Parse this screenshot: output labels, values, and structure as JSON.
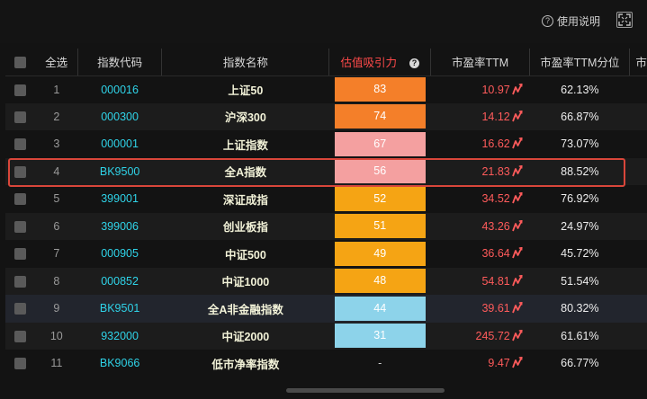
{
  "toolbar": {
    "help_label": "使用说明",
    "help_icon": "question-circle-icon",
    "fullscreen_icon": "fullscreen-icon"
  },
  "table": {
    "headers": {
      "select_all": "全选",
      "code": "指数代码",
      "name": "指数名称",
      "score": "估值吸引力",
      "pe": "市盈率TTM",
      "pe_pct": "市盈率TTM分位",
      "more": "市"
    },
    "accent_header_color": "#ff4a4a",
    "rows": [
      {
        "idx": "1",
        "code": "000016",
        "name": "上证50",
        "score": "83",
        "score_color": "#f47f29",
        "pe": "10.97",
        "pct": "62.13%"
      },
      {
        "idx": "2",
        "code": "000300",
        "name": "沪深300",
        "score": "74",
        "score_color": "#f47f29",
        "pe": "14.12",
        "pct": "66.87%"
      },
      {
        "idx": "3",
        "code": "000001",
        "name": "上证指数",
        "score": "67",
        "score_color": "#f4a0a0",
        "pe": "16.62",
        "pct": "73.07%"
      },
      {
        "idx": "4",
        "code": "BK9500",
        "name": "全A指数",
        "score": "56",
        "score_color": "#f4a0a0",
        "pe": "21.83",
        "pct": "88.52%"
      },
      {
        "idx": "5",
        "code": "399001",
        "name": "深证成指",
        "score": "52",
        "score_color": "#f5a414",
        "pe": "34.52",
        "pct": "76.92%"
      },
      {
        "idx": "6",
        "code": "399006",
        "name": "创业板指",
        "score": "51",
        "score_color": "#f5a414",
        "pe": "43.26",
        "pct": "24.97%"
      },
      {
        "idx": "7",
        "code": "000905",
        "name": "中证500",
        "score": "49",
        "score_color": "#f5a414",
        "pe": "36.64",
        "pct": "45.72%"
      },
      {
        "idx": "8",
        "code": "000852",
        "name": "中证1000",
        "score": "48",
        "score_color": "#f5a414",
        "pe": "54.81",
        "pct": "51.54%"
      },
      {
        "idx": "9",
        "code": "BK9501",
        "name": "全A非金融指数",
        "score": "44",
        "score_color": "#8dd3ea",
        "pe": "39.61",
        "pct": "80.32%"
      },
      {
        "idx": "10",
        "code": "932000",
        "name": "中证2000",
        "score": "31",
        "score_color": "#8dd3ea",
        "pe": "245.72",
        "pct": "61.61%"
      },
      {
        "idx": "11",
        "code": "BK9066",
        "name": "低市净率指数",
        "score": "-",
        "score_color": "",
        "pe": "9.47",
        "pct": "66.77%"
      }
    ],
    "highlighted_row": "4",
    "trend_icon": "trend-line-icon",
    "trend_color": "#ff5b5b"
  }
}
